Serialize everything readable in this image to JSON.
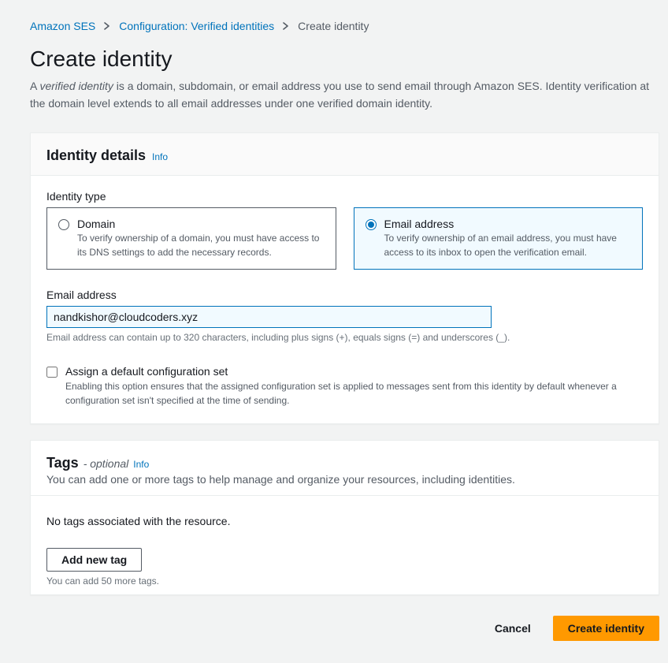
{
  "breadcrumb": {
    "items": [
      {
        "label": "Amazon SES",
        "link": true
      },
      {
        "label": "Configuration: Verified identities",
        "link": true
      },
      {
        "label": "Create identity",
        "link": false
      }
    ]
  },
  "page": {
    "title": "Create identity",
    "description_prefix": "A ",
    "description_ital": "verified identity",
    "description_rest": " is a domain, subdomain, or email address you use to send email through Amazon SES. Identity verification at the domain level extends to all email addresses under one verified domain identity."
  },
  "identity_details": {
    "title": "Identity details",
    "info_label": "Info",
    "type_label": "Identity type",
    "options": {
      "domain": {
        "title": "Domain",
        "desc": "To verify ownership of a domain, you must have access to its DNS settings to add the necessary records.",
        "selected": false
      },
      "email": {
        "title": "Email address",
        "desc": "To verify ownership of an email address, you must have access to its inbox to open the verification email.",
        "selected": true
      }
    },
    "email_field": {
      "label": "Email address",
      "value": "nandkishor@cloudcoders.xyz",
      "help": "Email address can contain up to 320 characters, including plus signs (+), equals signs (=) and underscores (_)."
    },
    "config_set": {
      "label": "Assign a default configuration set",
      "desc": "Enabling this option ensures that the assigned configuration set is applied to messages sent from this identity by default whenever a configuration set isn't specified at the time of sending."
    }
  },
  "tags": {
    "title": "Tags",
    "suffix": "- optional",
    "info_label": "Info",
    "desc": "You can add one or more tags to help manage and organize your resources, including identities.",
    "empty": "No tags associated with the resource.",
    "add_button": "Add new tag",
    "remaining": "You can add 50 more tags."
  },
  "footer": {
    "cancel": "Cancel",
    "submit": "Create identity"
  }
}
